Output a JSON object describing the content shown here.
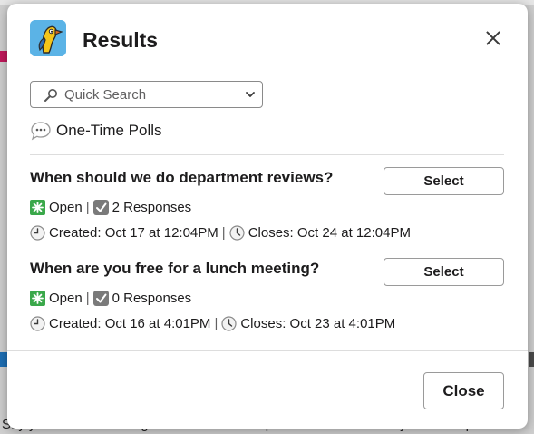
{
  "background": {
    "bottom_text": "Say your recent message: This channel is open to all members of your workspace"
  },
  "modal": {
    "title": "Results",
    "close_icon": "close-icon",
    "search": {
      "placeholder": "Quick Search",
      "icon": "magnifier-icon"
    },
    "section": {
      "icon": "speech-bubble-icon",
      "label": "One-Time Polls"
    },
    "polls": [
      {
        "question": "When should we do department reviews?",
        "select_label": "Select",
        "status": "Open",
        "responses": "2 Responses",
        "created": "Created: Oct 17 at 12:04PM",
        "closes": "Closes: Oct 24 at 12:04PM"
      },
      {
        "question": "When are you free for a lunch meeting?",
        "select_label": "Select",
        "status": "Open",
        "responses": "0 Responses",
        "created": "Created: Oct 16 at 4:01PM",
        "closes": "Closes: Oct 23 at 4:01PM"
      }
    ],
    "separator": "|",
    "close_button": "Close"
  },
  "colors": {
    "open_badge": "#3aa84a",
    "check_badge": "#7a7a7a",
    "app_icon_bg": "#5bb3e6",
    "bird": "#f5c518"
  }
}
